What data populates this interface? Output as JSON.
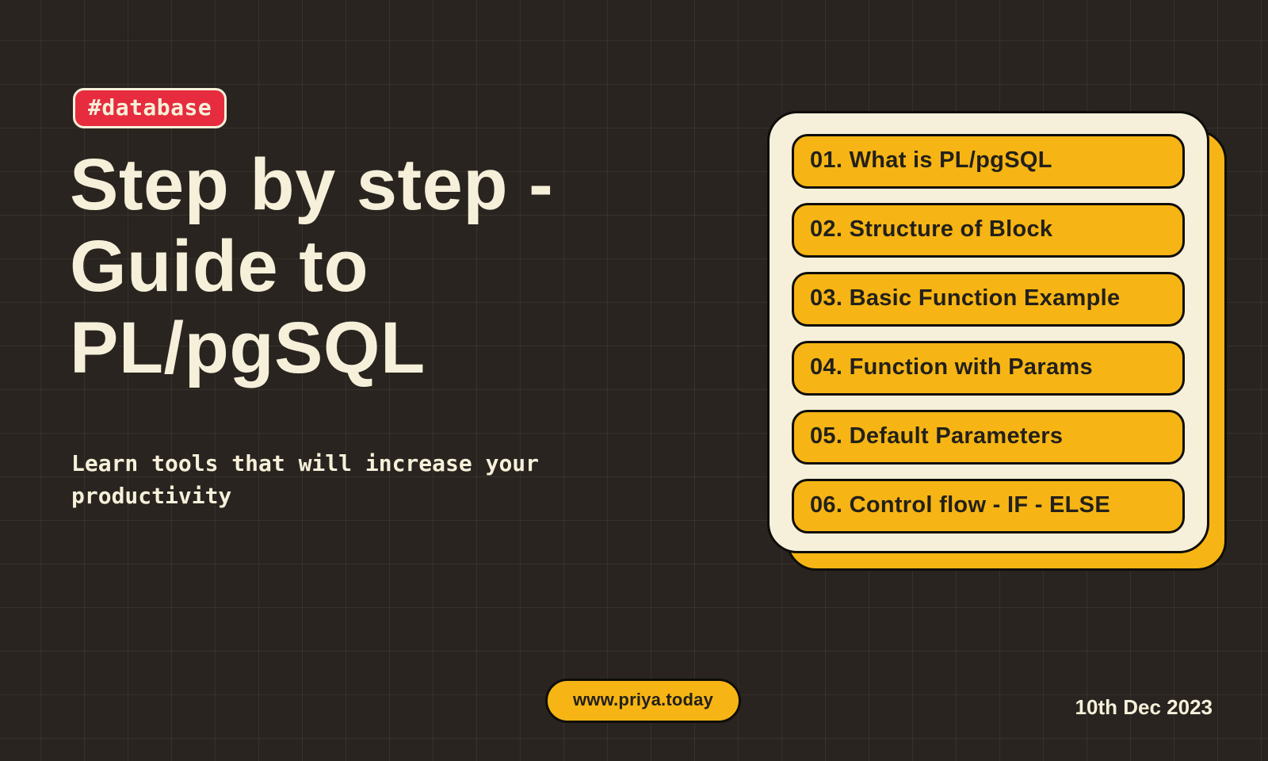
{
  "tag": "#database",
  "title": "Step by step - Guide to PL/pgSQL",
  "subtitle": "Learn tools that will increase your productivity",
  "toc": [
    {
      "num": "01.",
      "label": "What is PL/pgSQL"
    },
    {
      "num": "02.",
      "label": "Structure of  Block"
    },
    {
      "num": "03.",
      "label": " Basic Function Example"
    },
    {
      "num": "04.",
      "label": "Function with Params"
    },
    {
      "num": "05.",
      "label": "Default Parameters"
    },
    {
      "num": "06.",
      "label": "Control flow - IF - ELSE"
    }
  ],
  "site": "www.priya.today",
  "date": "10th Dec 2023",
  "colors": {
    "bg": "#29241f",
    "cream": "#f6f0da",
    "amber": "#f6b514",
    "red": "#e62c3e",
    "ink": "#0f0d0b"
  }
}
